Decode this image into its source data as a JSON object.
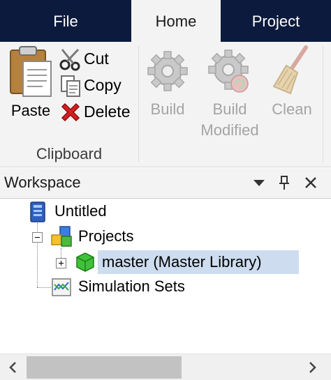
{
  "tabs": {
    "file": "File",
    "home": "Home",
    "project": "Project"
  },
  "clipboard": {
    "paste": "Paste",
    "cut": "Cut",
    "copy": "Copy",
    "delete": "Delete",
    "group_label": "Clipboard"
  },
  "build": {
    "build": "Build",
    "build_modified_line1": "Build",
    "build_modified_line2": "Modified",
    "clean": "Clean"
  },
  "workspace": {
    "title": "Workspace",
    "tree": {
      "root": "Untitled",
      "projects": "Projects",
      "master": "master (Master Library)",
      "simulation_sets": "Simulation Sets"
    }
  },
  "colors": {
    "tab_bar": "#0c1a3e",
    "ribbon_bg": "#f3f3f3",
    "selection": "#cddcee",
    "disabled_text": "#a4a4a4"
  }
}
